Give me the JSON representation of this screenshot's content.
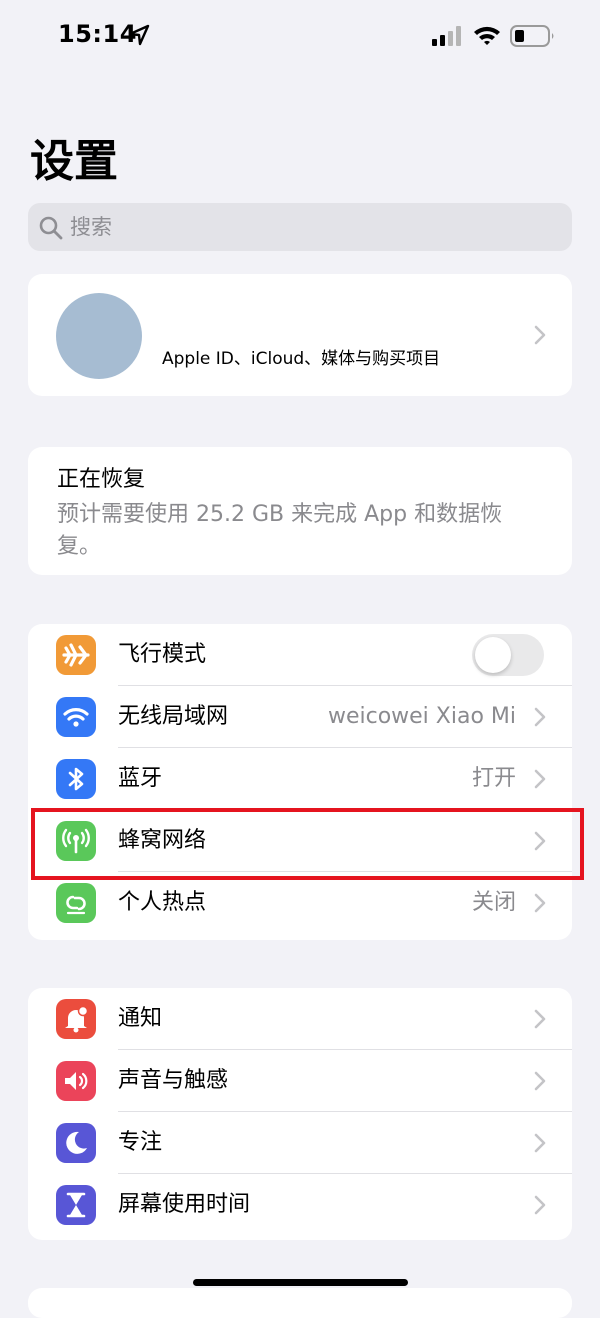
{
  "status_bar": {
    "time": "15:14",
    "icons": [
      "location-icon",
      "signal-icon",
      "wifi-icon",
      "battery-icon"
    ]
  },
  "title": "设置",
  "search": {
    "placeholder": "搜索",
    "value": ""
  },
  "profile": {
    "label": "Apple ID、iCloud、媒体与购买项目",
    "avatar_color": "#a6bcd2"
  },
  "restore": {
    "title": "正在恢复",
    "description": "预计需要使用 25.2 GB 来完成 App 和数据恢复。"
  },
  "connectivity": [
    {
      "label": "飞行模式",
      "icon": "airplane-icon",
      "color": "#f19a37",
      "toggle": false
    },
    {
      "label": "无线局域网",
      "icon": "wifi-icon",
      "color": "#3478f6",
      "value": "weicowei Xiao Mi"
    },
    {
      "label": "蓝牙",
      "icon": "bluetooth-icon",
      "color": "#3478f6",
      "value": "打开"
    },
    {
      "label": "蜂窝网络",
      "icon": "antenna-icon",
      "color": "#5ac85a",
      "highlighted": true
    },
    {
      "label": "个人热点",
      "icon": "hotspot-icon",
      "color": "#5ac85a",
      "value": "关闭"
    }
  ],
  "notifications": [
    {
      "label": "通知",
      "icon": "bell-icon",
      "color": "#eb4d3d"
    },
    {
      "label": "声音与触感",
      "icon": "speaker-icon",
      "color": "#eb445a"
    },
    {
      "label": "专注",
      "icon": "moon-icon",
      "color": "#5856d6"
    },
    {
      "label": "屏幕使用时间",
      "icon": "hourglass-icon",
      "color": "#5856d6"
    }
  ],
  "annotation": {
    "highlight_color": "#e5141f"
  }
}
